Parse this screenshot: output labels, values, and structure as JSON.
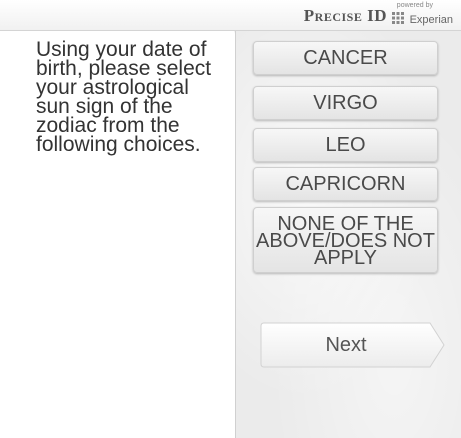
{
  "header": {
    "brand": "Precise ID",
    "powered_by": "powered by",
    "partner": "Experian",
    "partner_icon": "experian-dots-icon"
  },
  "question": {
    "text": "Using your date of birth, please select your astrological sun sign of the zodiac from the following choices."
  },
  "choices": [
    {
      "label": "CANCER"
    },
    {
      "label": "VIRGO"
    },
    {
      "label": "LEO"
    },
    {
      "label": "CAPRICORN"
    },
    {
      "label": "NONE OF THE ABOVE/DOES NOT APPLY"
    }
  ],
  "next_button": {
    "label": "Next"
  }
}
